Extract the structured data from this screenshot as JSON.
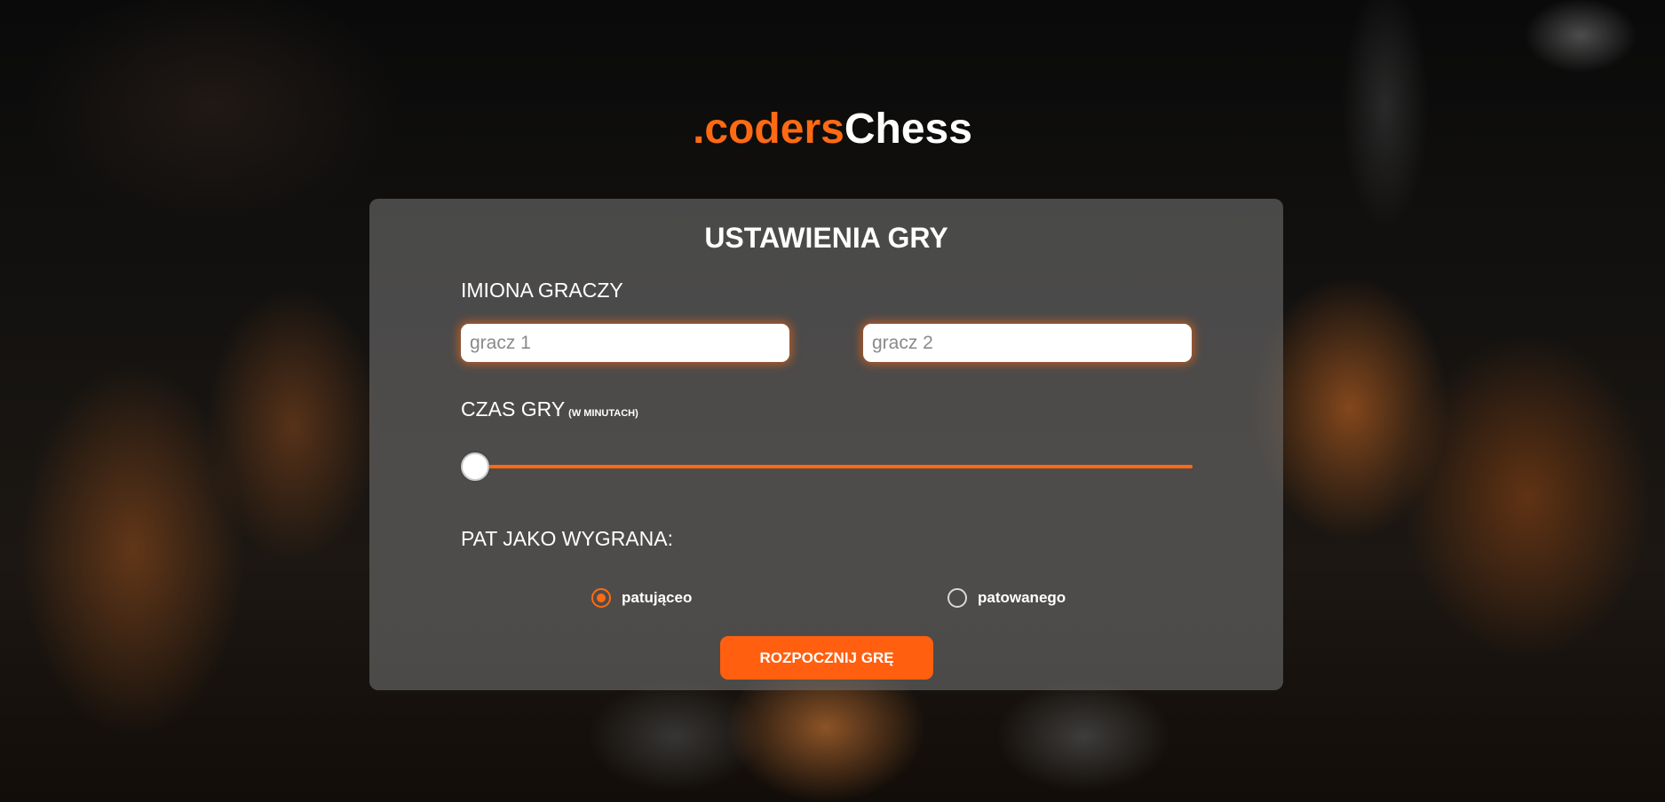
{
  "logo": {
    "accent": ".coders",
    "main": "Chess"
  },
  "settings": {
    "title": "USTAWIENIA GRY",
    "players_label": "IMIONA GRACZY",
    "player1_placeholder": "gracz 1",
    "player2_placeholder": "gracz 2",
    "time_label": "CZAS GRY",
    "time_unit": "(W MINUTACH)",
    "time_slider_value_fraction": 0,
    "stalemate_label": "PAT JAKO WYGRANA:",
    "stalemate_options": [
      {
        "label": "patująceo",
        "checked": true
      },
      {
        "label": "patowanego",
        "checked": false
      }
    ],
    "start_button": "ROZPOCZNIJ GRĘ"
  },
  "colors": {
    "accent": "#ff6a13",
    "panel": "rgba(110,110,110,0.62)",
    "text": "#ffffff"
  }
}
